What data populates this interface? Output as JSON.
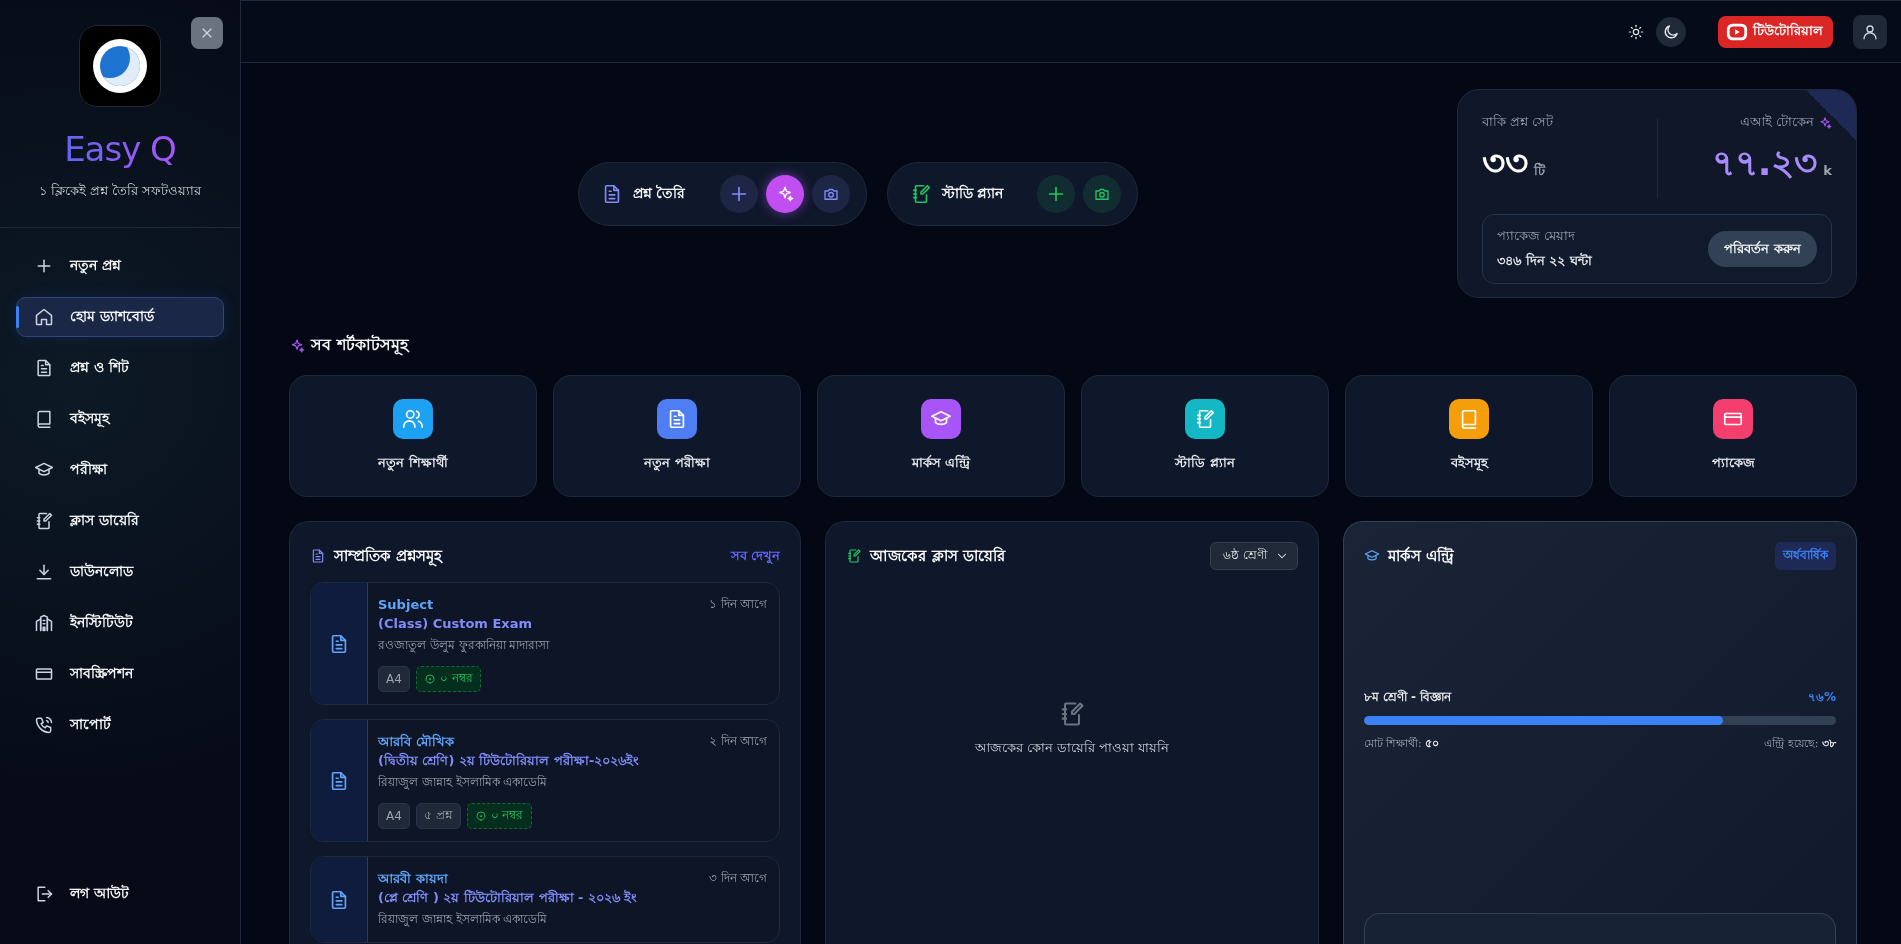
{
  "sidebar": {
    "brand": "Easy Q",
    "tagline": "১ ক্লিকেই প্রশ্ন তৈরি সফটওয়্যার",
    "items": [
      {
        "label": "নতুন প্রশ্ন",
        "selected": false
      },
      {
        "label": "হোম ড্যাশবোর্ড",
        "selected": true
      },
      {
        "label": "প্রশ্ন ও শিট",
        "selected": false
      },
      {
        "label": "বইসমূহ",
        "selected": false
      },
      {
        "label": "পরীক্ষা",
        "selected": false
      },
      {
        "label": "ক্লাস ডায়েরি",
        "selected": false
      },
      {
        "label": "ডাউনলোড",
        "selected": false
      },
      {
        "label": "ইনস্টিটিউট",
        "selected": false
      },
      {
        "label": "সাবস্ক্রিপশন",
        "selected": false
      },
      {
        "label": "সাপোর্ট",
        "selected": false
      }
    ],
    "logout": "লগ আউট"
  },
  "topbar": {
    "tutorial": "টিউটোরিয়াল"
  },
  "quick_actions": [
    {
      "label": "প্রশ্ন তৈরি",
      "color": "#818cf8"
    },
    {
      "label": "স্টাডি প্ল্যান",
      "color": "#22c55e"
    }
  ],
  "stats": {
    "sets": {
      "label": "বাকি প্রশ্ন সেট",
      "value": "৩৩",
      "unit": "টি"
    },
    "tokens": {
      "label": "এআই টোকেন",
      "value": "৭৭.২৩",
      "unit": "k"
    },
    "package": {
      "label": "প্যাকেজ মেয়াদ",
      "value": "৩৪৬ দিন ২২ ঘন্টা",
      "button": "পরিবর্তন করুন"
    }
  },
  "shortcuts": {
    "title": "সব শর্টকাটসমূহ",
    "items": [
      {
        "label": "নতুন শিক্ষার্থী",
        "color": "#1da1f2"
      },
      {
        "label": "নতুন পরীক্ষা",
        "color": "#4f7df3"
      },
      {
        "label": "মার্কস এন্ট্রি",
        "color": "#a855f7"
      },
      {
        "label": "স্টাডি প্ল্যান",
        "color": "#14b8c4"
      },
      {
        "label": "বইসমূহ",
        "color": "#f59e0b"
      },
      {
        "label": "প্যাকেজ",
        "color": "#f43f6e"
      }
    ]
  },
  "recent": {
    "title": "সাম্প্রতিক প্রশ্নসমূহ",
    "link": "সব দেখুন",
    "items": [
      {
        "title": "Subject",
        "subtitle": "(Class) Custom Exam",
        "institute": "রওজাতুল উলুম ফুরকানিয়া মাদারাসা",
        "time": "১ দিন আগে",
        "tags": [
          {
            "text": "A4",
            "kind": "plain"
          },
          {
            "text": "০ নম্বর",
            "kind": "marks"
          }
        ]
      },
      {
        "title": "আরবি মৌখিক",
        "subtitle": "(দ্বিতীয় শ্রেণি) ২য় টিউটোরিয়াল পরীক্ষা-২০২৬ইং",
        "institute": "রিয়াজুল জান্নাহ ইসলামিক একাডেমি",
        "time": "২ দিন আগে",
        "tags": [
          {
            "text": "A4",
            "kind": "plain"
          },
          {
            "text": "৫ প্রশ্ন",
            "kind": "plain"
          },
          {
            "text": "০ নম্বর",
            "kind": "marks"
          }
        ]
      },
      {
        "title": "আরবী কায়দা",
        "subtitle": "(প্লে শ্রেণি ) ২য় টিউটোরিয়াল পরীক্ষা - ২০২৬ ইং",
        "institute": "রিয়াজুল জান্নাহ ইসলামিক একাডেমি",
        "time": "৩ দিন আগে"
      }
    ]
  },
  "diary": {
    "title": "আজকের ক্লাস ডায়েরি",
    "select": "৬ষ্ঠ শ্রেণী",
    "empty": "আজকের কোন ডায়েরি পাওয়া যায়নি"
  },
  "marks": {
    "title": "মার্কস এন্ট্রি",
    "badge": "অর্ধবার্ষিক",
    "progress": {
      "label": "৮ম শ্রেণী - বিজ্ঞান",
      "percent": "৭৬%",
      "level": 0.76,
      "total_label": "মোট শিক্ষার্থী:",
      "total": "৫০",
      "entered_label": "এন্ট্রি হয়েছে:",
      "entered": "৩৮"
    }
  }
}
